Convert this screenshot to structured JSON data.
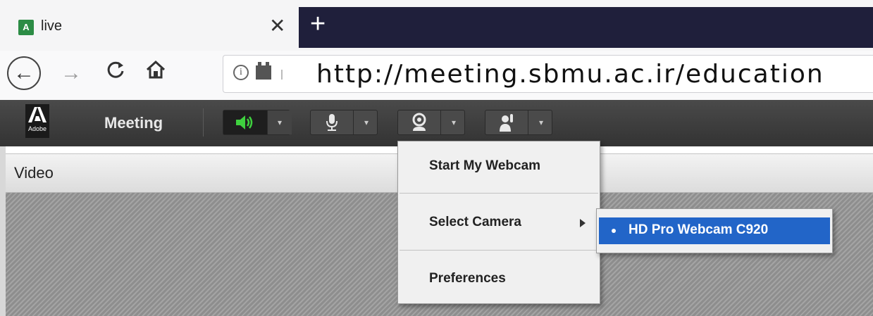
{
  "browser": {
    "tab": {
      "favicon_icon": "adobe-connect-favicon",
      "title": "live",
      "close_glyph": "✕"
    },
    "new_tab_glyph": "+",
    "nav": {
      "back_glyph": "←",
      "forward_glyph": "→",
      "reload_glyph": "C",
      "home_glyph": "⌂"
    },
    "address": {
      "url": "http://meeting.sbmu.ac.ir/education",
      "info_glyph": "i"
    }
  },
  "app": {
    "logo_text": "Adobe",
    "title": "Meeting",
    "toolbar": {
      "audio_icon": "speaker-icon",
      "mic_icon": "microphone-icon",
      "webcam_icon": "webcam-icon",
      "hand_icon": "raise-hand-icon",
      "dropdown_glyph": "▾",
      "accent_green": "#3fd13f"
    }
  },
  "pod": {
    "title": "Video"
  },
  "webcam_menu": {
    "items": [
      {
        "label": "Start My Webcam"
      },
      {
        "label": "Select Camera",
        "has_submenu": true
      },
      {
        "label": "Preferences"
      }
    ],
    "camera_submenu": {
      "items": [
        {
          "label": "HD Pro Webcam C920",
          "selected": true
        }
      ],
      "highlight_color": "#2265c8"
    }
  }
}
